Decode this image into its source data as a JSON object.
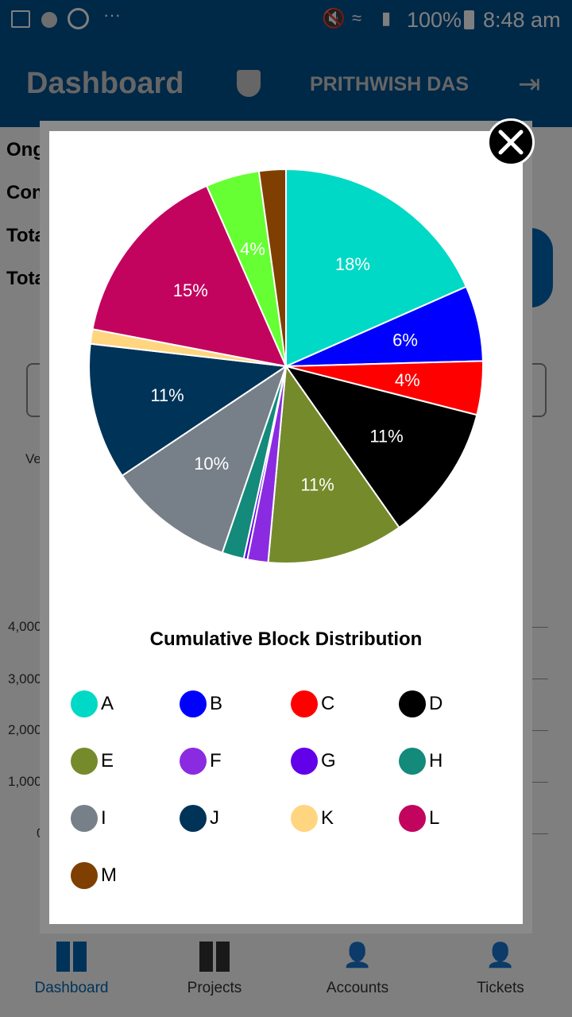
{
  "status_bar": {
    "time": "8:48 am",
    "battery": "100%",
    "icons": [
      "gallery-icon",
      "zedge-icon",
      "whatsapp-icon",
      "more-icon",
      "mute-icon",
      "wifi-icon",
      "signal-icon",
      "battery-icon"
    ]
  },
  "header": {
    "title": "Dashboard",
    "user": "PRITHWISH DAS",
    "icons": [
      "admin-shield-icon",
      "logout-icon"
    ]
  },
  "background": {
    "rows": [
      "Ong",
      "Con",
      "Tota",
      "Tota"
    ],
    "chart_label": "Ve",
    "y_ticks": [
      "4,000",
      "3,000",
      "2,000",
      "1,000",
      "0"
    ],
    "accent": "#00508f"
  },
  "modal": {
    "close_icon": "close-icon"
  },
  "chart_data": {
    "type": "pie",
    "title": "Cumulative Block Distribution",
    "slices": [
      {
        "name": "A",
        "value": 18.4,
        "color": "#00d9c5"
      },
      {
        "name": "B",
        "value": 6.2,
        "color": "#0000ff"
      },
      {
        "name": "C",
        "value": 4.4,
        "color": "#ff0000"
      },
      {
        "name": "D",
        "value": 11.3,
        "color": "#000000"
      },
      {
        "name": "E",
        "value": 11.2,
        "color": "#758a2a"
      },
      {
        "name": "F",
        "value": 1.7,
        "color": "#8a2be2"
      },
      {
        "name": "G",
        "value": 0.3,
        "color": "#6200ea"
      },
      {
        "name": "H",
        "value": 1.8,
        "color": "#138a7a"
      },
      {
        "name": "I",
        "value": 10.4,
        "color": "#778088"
      },
      {
        "name": "J",
        "value": 11.2,
        "color": "#003358"
      },
      {
        "name": "K",
        "value": 1.2,
        "color": "#ffd580"
      },
      {
        "name": "L",
        "value": 15.4,
        "color": "#c2045f"
      },
      {
        "value": 4.4,
        "color": "#66ff33"
      },
      {
        "name": "M",
        "value": 2.2,
        "color": "#7f3f00"
      }
    ],
    "legend": [
      "A",
      "B",
      "C",
      "D",
      "E",
      "F",
      "G",
      "H",
      "I",
      "J",
      "K",
      "L",
      "M"
    ],
    "legend_placement": "bottom"
  },
  "bottom_nav": [
    {
      "label": "Dashboard",
      "icon": "dashboard-icon",
      "active": true
    },
    {
      "label": "Projects",
      "icon": "projects-icon"
    },
    {
      "label": "Accounts",
      "icon": "accounts-settings-icon"
    },
    {
      "label": "Tickets",
      "icon": "tickets-settings-icon"
    }
  ]
}
